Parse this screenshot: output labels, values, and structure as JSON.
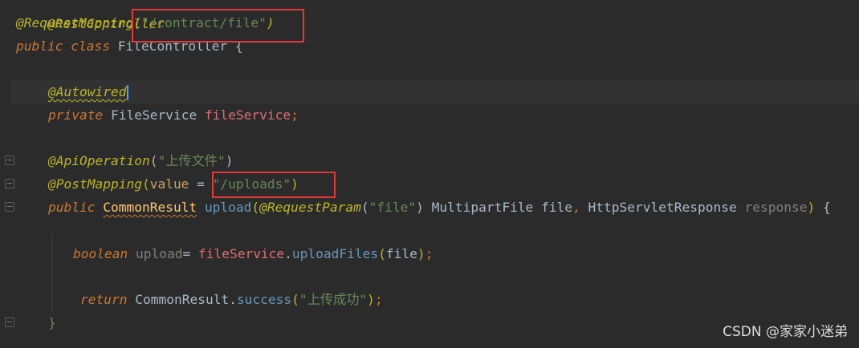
{
  "editor": {
    "lines": [
      {
        "id": "rest-controller",
        "text": "@RestController"
      },
      {
        "id": "request-mapping",
        "ann": "@RequestMapping",
        "open": "(",
        "path": "\"/contract/file\"",
        "close": ")"
      },
      {
        "id": "class-decl",
        "kw1": "public",
        "kw2": "class",
        "name": "FileController",
        "brace": "{"
      },
      {
        "id": "autowired",
        "ann": "@Autowired"
      },
      {
        "id": "field-decl",
        "kw": "private",
        "type": "FileService",
        "name": "fileService",
        "semi": ";"
      },
      {
        "id": "api-operation",
        "ann": "@ApiOperation",
        "open": "(",
        "str": "\"上传文件\"",
        "close": ")"
      },
      {
        "id": "post-mapping",
        "ann": "@PostMapping",
        "open": "(",
        "attr": "value",
        "eq": " = ",
        "str": "\"/uploads\"",
        "close": ")"
      },
      {
        "id": "method-decl",
        "kw": "public",
        "ret": "CommonResult",
        "name": "upload",
        "open": "(",
        "pann": "@RequestParam",
        "popen": "(",
        "pstr": "\"file\"",
        "pclose": ")",
        "ptype1": "MultipartFile",
        "pname1": "file",
        "comma": ",",
        "ptype2": "HttpServletResponse",
        "pname2": "response",
        "close": ")",
        "brace": "{"
      },
      {
        "id": "upload-call",
        "kw": "boolean",
        "var": "upload",
        "eq": "=",
        "obj": "fileService",
        "dot": ".",
        "call": "uploadFiles",
        "open": "(",
        "arg": "file",
        "close": ")",
        "semi": ";"
      },
      {
        "id": "return-stmt",
        "kw": "return",
        "cls": "CommonResult",
        "dot": ".",
        "call": "success",
        "open": "(",
        "str": "\"上传成功\"",
        "close": ")",
        "semi": ";"
      },
      {
        "id": "close-brace",
        "text": "}"
      }
    ]
  },
  "highlights": {
    "color": "#e4393c",
    "targets": [
      "/contract/file",
      "/uploads"
    ]
  },
  "watermark": "CSDN @家家小迷弟",
  "colors": {
    "background": "#2b2b2b",
    "annotation": "#bbb529",
    "keyword": "#cc7832",
    "string": "#6a8759",
    "field": "#9876aa",
    "method": "#ffc66d",
    "call": "#6897bb",
    "text": "#a9b7c6"
  }
}
